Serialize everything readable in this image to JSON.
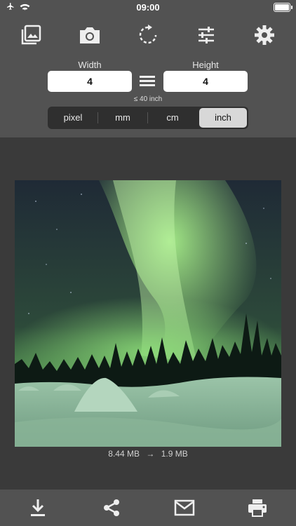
{
  "status_bar": {
    "time": "09:00",
    "left_icons": [
      "airplane-icon",
      "wifi-icon"
    ],
    "battery_icon": "battery-icon",
    "battery_level": 1.0
  },
  "toolbar": {
    "icons": [
      "gallery-icon",
      "camera-icon",
      "rotate-icon",
      "sliders-icon",
      "gear-icon"
    ]
  },
  "size": {
    "width_label": "Width",
    "height_label": "Height",
    "width_value": "4",
    "height_value": "4",
    "link_icon": "equals-icon",
    "hint": "≤ 40 inch"
  },
  "units": {
    "options": [
      "pixel",
      "mm",
      "cm",
      "inch"
    ],
    "selected": "inch"
  },
  "image": {
    "description_icon": "aurora-photo"
  },
  "file_size": {
    "original": "8.44 MB",
    "arrow": "→",
    "result": "1.9 MB"
  },
  "bottom_bar": {
    "icons": [
      "download-icon",
      "share-icon",
      "mail-icon",
      "print-icon"
    ]
  },
  "colors": {
    "panel": "#525252",
    "background": "#3a3a3a",
    "aurora": "#8fe07a"
  }
}
